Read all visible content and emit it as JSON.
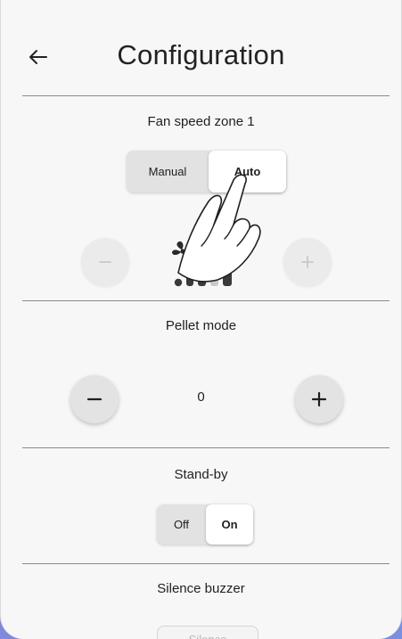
{
  "header": {
    "title": "Configuration",
    "back_icon": "arrow-left-icon"
  },
  "fan_zone": {
    "title": "Fan speed zone 1",
    "mode_options": [
      "Manual",
      "Auto"
    ],
    "selected_mode": "Auto",
    "speed_icon": "fan-speed-icon",
    "gesture_icon": "tap-hand-icon"
  },
  "pellet": {
    "title": "Pellet mode",
    "value": "0"
  },
  "standby": {
    "title": "Stand-by",
    "options": [
      "Off",
      "On"
    ],
    "selected": "On"
  },
  "buzzer": {
    "title": "Silence buzzer",
    "button_label": "Silence"
  },
  "colors": {
    "accent_bg": "#f7f7f7",
    "frame": "#8a7fd6",
    "active_option": "#ffffff"
  }
}
